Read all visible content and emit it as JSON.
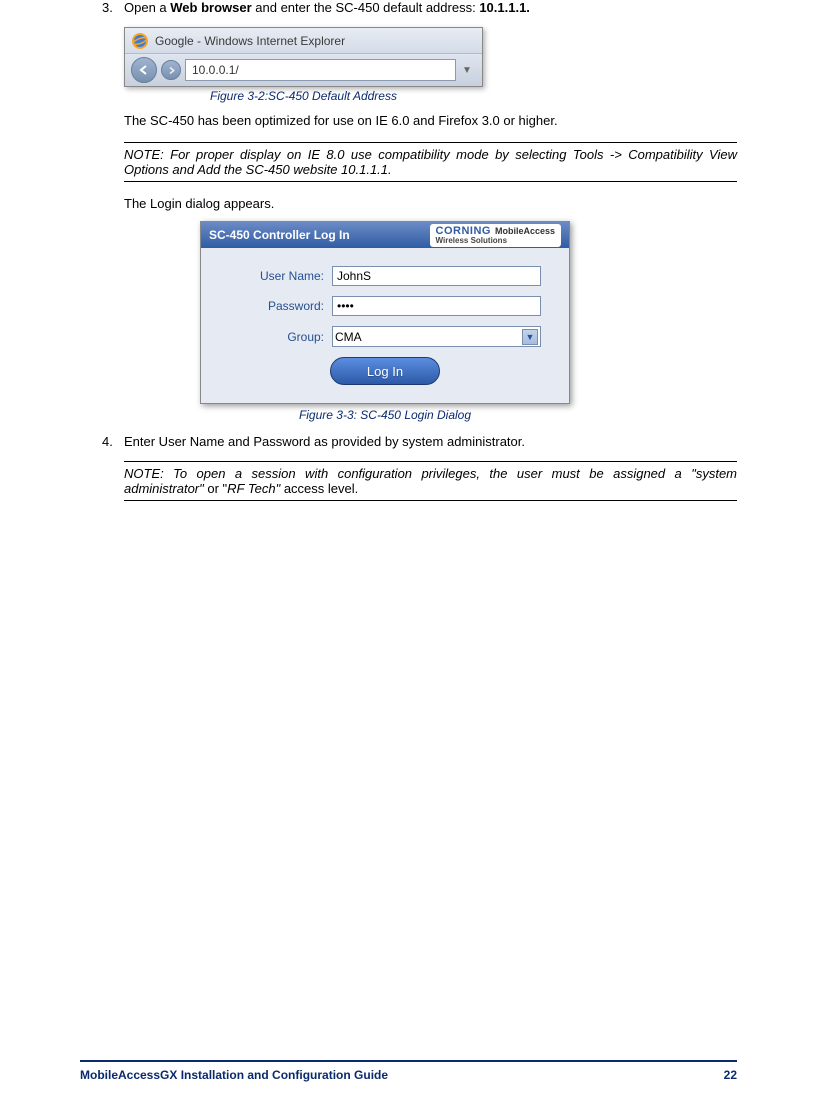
{
  "step3": {
    "number": "3.",
    "prefix": "Open a ",
    "bold1": "Web browser",
    "mid": " and enter the SC-450 default address: ",
    "bold2": "10.1.1.1."
  },
  "browser": {
    "title": "Google - Windows Internet Explorer",
    "url": "10.0.0.1/"
  },
  "figure1_caption": "Figure 3-2:SC-450 Default Address",
  "para_after_fig1": "The SC-450 has been optimized for use on IE 6.0 and Firefox 3.0 or higher.",
  "note1": "NOTE: For proper display on IE 8.0 use compatibility mode by selecting Tools -> Compatibility View Options and Add the SC-450 website 10.1.1.1.",
  "login_intro": "The Login dialog appears.",
  "login": {
    "title": "SC-450 Controller Log In",
    "brand_main": "CORNING",
    "brand_sub1": "MobileAccess",
    "brand_sub2": "Wireless Solutions",
    "username_label": "User Name:",
    "username_value": "JohnS",
    "password_label": "Password:",
    "password_value": "••••",
    "group_label": "Group:",
    "group_value": "CMA",
    "button": "Log In"
  },
  "figure2_caption": "Figure 3-3: SC-450 Login Dialog",
  "step4": {
    "number": "4.",
    "text": "Enter User Name and Password as provided by system administrator."
  },
  "note2": {
    "prefix": "NOTE: To open a session with configuration privileges, the user must be assigned a \"system administrator\"",
    "mid_plain": " or \"",
    "rftech": "RF Tech\"",
    "suffix_plain": " access level."
  },
  "footer": {
    "title": "MobileAccessGX Installation and Configuration Guide",
    "page": "22"
  }
}
